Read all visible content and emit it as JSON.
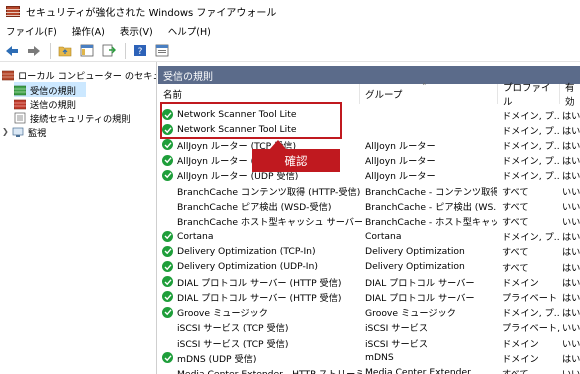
{
  "window": {
    "title": "セキュリティが強化された Windows ファイアウォール"
  },
  "menu": {
    "items": [
      "ファイル(F)",
      "操作(A)",
      "表示(V)",
      "ヘルプ(H)"
    ]
  },
  "toolbar": {
    "buttons": [
      "back-icon",
      "forward-icon",
      "folder-up-icon",
      "show-hide-tree-icon",
      "export-list-icon",
      "help-icon",
      "properties-icon"
    ]
  },
  "tree": {
    "root": "ローカル コンピューター のセキュリティ",
    "items": [
      {
        "label": "受信の規則",
        "selected": true
      },
      {
        "label": "送信の規則",
        "selected": false
      },
      {
        "label": "接続セキュリティの規則",
        "selected": false
      },
      {
        "label": "監視",
        "selected": false
      }
    ]
  },
  "main": {
    "section_title": "受信の規則",
    "columns": [
      "名前",
      "グループ",
      "プロファイル",
      "有効"
    ],
    "rows": [
      {
        "enabled": true,
        "name": "Network Scanner Tool Lite",
        "group": "",
        "profile": "ドメイン, プ...",
        "status": "はい"
      },
      {
        "enabled": true,
        "name": "Network Scanner Tool Lite",
        "group": "",
        "profile": "ドメイン, プ...",
        "status": "はい"
      },
      {
        "enabled": true,
        "name": "AllJoyn ルーター (TCP 受信)",
        "group": "AllJoyn ルーター",
        "profile": "ドメイン, プ...",
        "status": "はい"
      },
      {
        "enabled": true,
        "name": "AllJoyn ルーター (UDP 受信)",
        "group": "AllJoyn ルーター",
        "profile": "ドメイン, プ...",
        "status": "はい"
      },
      {
        "enabled": true,
        "name": "AllJoyn ルーター (UDP 受信)",
        "group": "AllJoyn ルーター",
        "profile": "ドメイン, プ...",
        "status": "はい"
      },
      {
        "enabled": false,
        "name": "BranchCache コンテンツ取得 (HTTP-受信)",
        "group": "BranchCache - コンテンツ取得...",
        "profile": "すべて",
        "status": "いい"
      },
      {
        "enabled": false,
        "name": "BranchCache ピア検出 (WSD-受信)",
        "group": "BranchCache - ピア検出 (WS...",
        "profile": "すべて",
        "status": "いい"
      },
      {
        "enabled": false,
        "name": "BranchCache ホスト型キャッシュ サーバー (HT...",
        "group": "BranchCache - ホスト型キャッ...",
        "profile": "すべて",
        "status": "いい"
      },
      {
        "enabled": true,
        "name": "Cortana",
        "group": "Cortana",
        "profile": "ドメイン, プ...",
        "status": "はい"
      },
      {
        "enabled": true,
        "name": "Delivery Optimization (TCP-In)",
        "group": "Delivery Optimization",
        "profile": "すべて",
        "status": "はい"
      },
      {
        "enabled": true,
        "name": "Delivery Optimization (UDP-In)",
        "group": "Delivery Optimization",
        "profile": "すべて",
        "status": "はい"
      },
      {
        "enabled": true,
        "name": "DIAL プロトコル サーバー (HTTP 受信)",
        "group": "DIAL プロトコル サーバー",
        "profile": "ドメイン",
        "status": "はい"
      },
      {
        "enabled": true,
        "name": "DIAL プロトコル サーバー (HTTP 受信)",
        "group": "DIAL プロトコル サーバー",
        "profile": "プライベート",
        "status": "はい"
      },
      {
        "enabled": true,
        "name": "Groove ミュージック",
        "group": "Groove ミュージック",
        "profile": "ドメイン, プ...",
        "status": "はい"
      },
      {
        "enabled": false,
        "name": "iSCSI サービス (TCP 受信)",
        "group": "iSCSI サービス",
        "profile": "プライベート,...",
        "status": "いい"
      },
      {
        "enabled": false,
        "name": "iSCSI サービス (TCP 受信)",
        "group": "iSCSI サービス",
        "profile": "ドメイン",
        "status": "いい"
      },
      {
        "enabled": true,
        "name": "mDNS (UDP 受信)",
        "group": "mDNS",
        "profile": "ドメイン",
        "status": "はい"
      },
      {
        "enabled": false,
        "name": "Media Center Extender - HTTP ストリーミング...",
        "group": "Media Center Extender",
        "profile": "すべて",
        "status": "いい"
      }
    ]
  },
  "annotation": {
    "callout_label": "確認"
  },
  "colors": {
    "section_header": "#5b6b8a",
    "highlight": "#c0191f",
    "check_green": "#1e9e3a",
    "tree_selected": "#cce8ff"
  }
}
